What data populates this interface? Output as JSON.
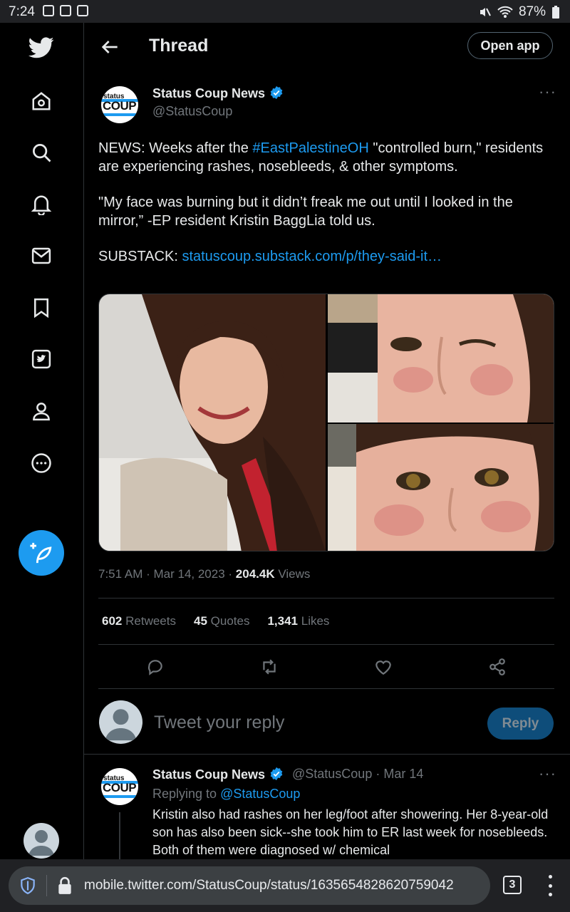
{
  "status_bar": {
    "time": "7:24",
    "battery": "87%"
  },
  "nav": {
    "items": [
      "twitter-logo",
      "home-icon",
      "search-icon",
      "notifications-icon",
      "messages-icon",
      "bookmarks-icon",
      "twitter-blue-icon",
      "profile-icon",
      "more-icon"
    ],
    "compose": "compose-tweet-icon"
  },
  "header": {
    "title": "Thread",
    "open_app": "Open app"
  },
  "tweet": {
    "author_name": "Status Coup News",
    "handle": "@StatusCoup",
    "logo_top": "status",
    "logo_main": "COUP",
    "more": "···",
    "text1_a": "NEWS: Weeks after the ",
    "text1_hashtag": "#EastPalestineOH",
    "text1_b": " \"controlled burn,\" residents are experiencing rashes, nosebleeds, & other symptoms.",
    "text2": "\"My face was burning but it didn’t freak me out until I looked in the mirror,” -EP resident Kristin BaggLia told us.",
    "text3_label": "SUBSTACK: ",
    "text3_link": "statuscoup.substack.com/p/they-said-it…",
    "time": "7:51 AM",
    "date": "Mar 14, 2023",
    "views_count": "204.4K",
    "views_label": "Views",
    "retweets_count": "602",
    "retweets_label": "Retweets",
    "quotes_count": "45",
    "quotes_label": "Quotes",
    "likes_count": "1,341",
    "likes_label": "Likes"
  },
  "reply_box": {
    "placeholder": "Tweet your reply",
    "button": "Reply"
  },
  "reply": {
    "author_name": "Status Coup News",
    "meta": "@StatusCoup · Mar 14",
    "replying_label": "Replying to ",
    "replying_handle": "@StatusCoup",
    "text": "Kristin also had rashes on her leg/foot after showering. Her 8-year-old son has also been sick--she took him to ER last week for nosebleeds. Both of them were diagnosed w/ chemical"
  },
  "browser": {
    "url": "mobile.twitter.com/StatusCoup/status/1635654828620759042",
    "tab_count": "3"
  },
  "colors": {
    "accent": "#1d9bf0",
    "background": "#000000",
    "muted": "#71767b",
    "divider": "#2f3336"
  }
}
